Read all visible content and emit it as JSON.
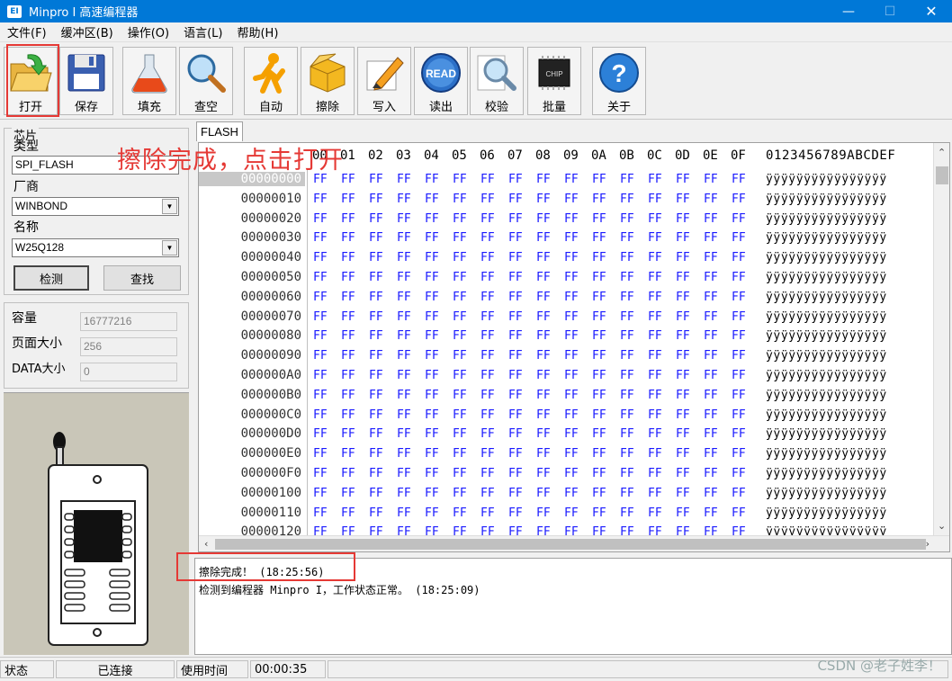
{
  "window": {
    "icon_text": "EI",
    "title": "Minpro I 高速编程器",
    "min": "—",
    "max": "☐",
    "close": "✕"
  },
  "menu": [
    "文件(F)",
    "缓冲区(B)",
    "操作(O)",
    "语言(L)",
    "帮助(H)"
  ],
  "toolbar": [
    {
      "label": "打开",
      "icon": "open-folder-icon"
    },
    {
      "label": "保存",
      "icon": "floppy-disk-icon"
    },
    {
      "label": "填充",
      "icon": "flask-icon"
    },
    {
      "label": "查空",
      "icon": "magnifier-icon"
    },
    {
      "label": "自动",
      "icon": "running-person-icon"
    },
    {
      "label": "擦除",
      "icon": "box-icon"
    },
    {
      "label": "写入",
      "icon": "pen-write-icon"
    },
    {
      "label": "读出",
      "icon": "read-disc-icon"
    },
    {
      "label": "校验",
      "icon": "verify-magnifier-icon"
    },
    {
      "label": "批量",
      "icon": "chip-icon"
    },
    {
      "label": "关于",
      "icon": "help-question-icon"
    }
  ],
  "read_icon_text": "READ",
  "chip_icon_text": "CHIP",
  "chip_panel": {
    "group_title": "芯片",
    "type_label": "类型",
    "type_value": "SPI_FLASH",
    "vendor_label": "厂商",
    "vendor_value": "WINBOND",
    "name_label": "名称",
    "name_value": "W25Q128",
    "detect_button": "检测",
    "find_button": "查找"
  },
  "info_panel": {
    "capacity_label": "容量",
    "capacity_value": "16777216",
    "page_label": "页面大小",
    "page_value": "256",
    "data_label": "DATA大小",
    "data_value": "0"
  },
  "tab": "FLASH",
  "hex": {
    "columns": [
      "00",
      "01",
      "02",
      "03",
      "04",
      "05",
      "06",
      "07",
      "08",
      "09",
      "0A",
      "0B",
      "0C",
      "0D",
      "0E",
      "0F"
    ],
    "ascii_header": "0123456789ABCDEF",
    "addresses": [
      "00000000",
      "00000010",
      "00000020",
      "00000030",
      "00000040",
      "00000050",
      "00000060",
      "00000070",
      "00000080",
      "00000090",
      "000000A0",
      "000000B0",
      "000000C0",
      "000000D0",
      "000000E0",
      "000000F0",
      "00000100",
      "00000110",
      "00000120"
    ],
    "byte_value": "FF",
    "ascii_row": "ÿÿÿÿÿÿÿÿÿÿÿÿÿÿÿÿ"
  },
  "annotation": "擦除完成，点击打开",
  "log": [
    "擦除完成！ (18:25:56)",
    "检测到编程器 Minpro I，工作状态正常。 (18:25:09)"
  ],
  "status": {
    "state_label": "状态",
    "connection": "已连接",
    "time_label": "使用时间",
    "time_value": "00:00:35"
  },
  "watermark": "CSDN @老子姓李！",
  "colors": {
    "titlebar": "#0078d7",
    "hex_byte": "#1a1aff",
    "highlight": "#e53935"
  }
}
